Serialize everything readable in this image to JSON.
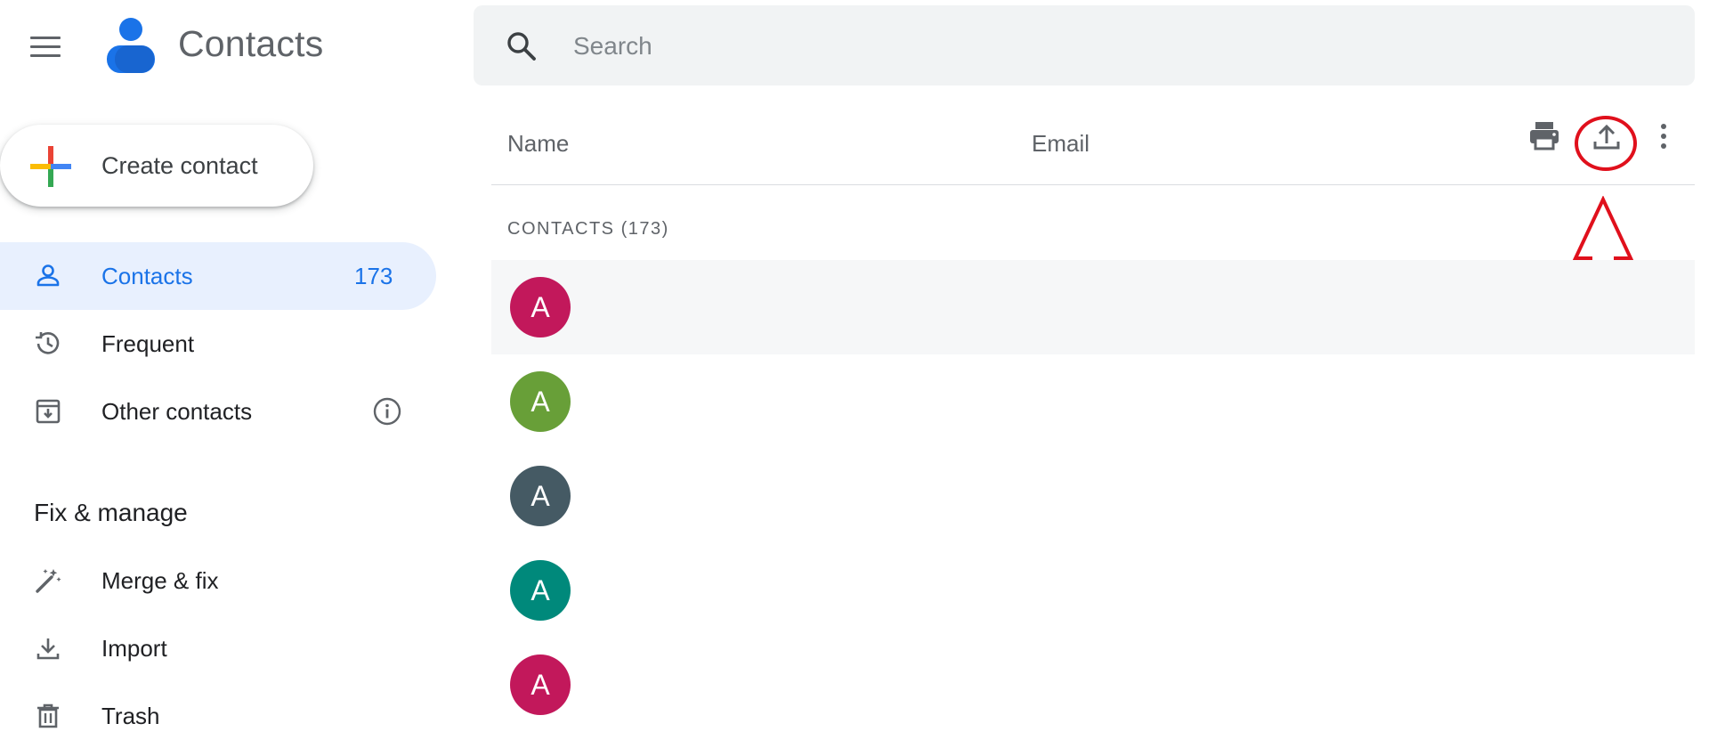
{
  "app": {
    "title": "Contacts",
    "menu_icon": "hamburger-icon",
    "logo_icon": "contacts-logo-icon"
  },
  "create_contact": {
    "label": "Create contact",
    "icon": "colored-plus-icon"
  },
  "sidebar": {
    "items": [
      {
        "label": "Contacts",
        "count": "173",
        "icon": "person-icon",
        "active": true
      },
      {
        "label": "Frequent",
        "icon": "history-icon"
      },
      {
        "label": "Other contacts",
        "icon": "archive-download-icon",
        "info_icon": "info-icon"
      }
    ],
    "section_title": "Fix & manage",
    "manage_items": [
      {
        "label": "Merge & fix",
        "icon": "magic-wand-icon"
      },
      {
        "label": "Import",
        "icon": "download-icon"
      },
      {
        "label": "Trash",
        "icon": "trash-icon"
      }
    ]
  },
  "search": {
    "placeholder": "Search",
    "value": "",
    "icon": "search-icon"
  },
  "table": {
    "columns": [
      "Name",
      "Email"
    ],
    "actions": [
      {
        "icon": "print-icon"
      },
      {
        "icon": "export-icon"
      },
      {
        "icon": "more-vert-icon"
      }
    ]
  },
  "group": {
    "label": "CONTACTS (173)"
  },
  "contacts": [
    {
      "initial": "A",
      "color": "#c2185b"
    },
    {
      "initial": "A",
      "color": "#689f38"
    },
    {
      "initial": "A",
      "color": "#455a64"
    },
    {
      "initial": "A",
      "color": "#00897b"
    },
    {
      "initial": "A",
      "color": "#c2185b"
    }
  ],
  "colors": {
    "accent": "#1a73e8",
    "active_bg": "#e8f0fe",
    "annotation": "#e0101c"
  }
}
